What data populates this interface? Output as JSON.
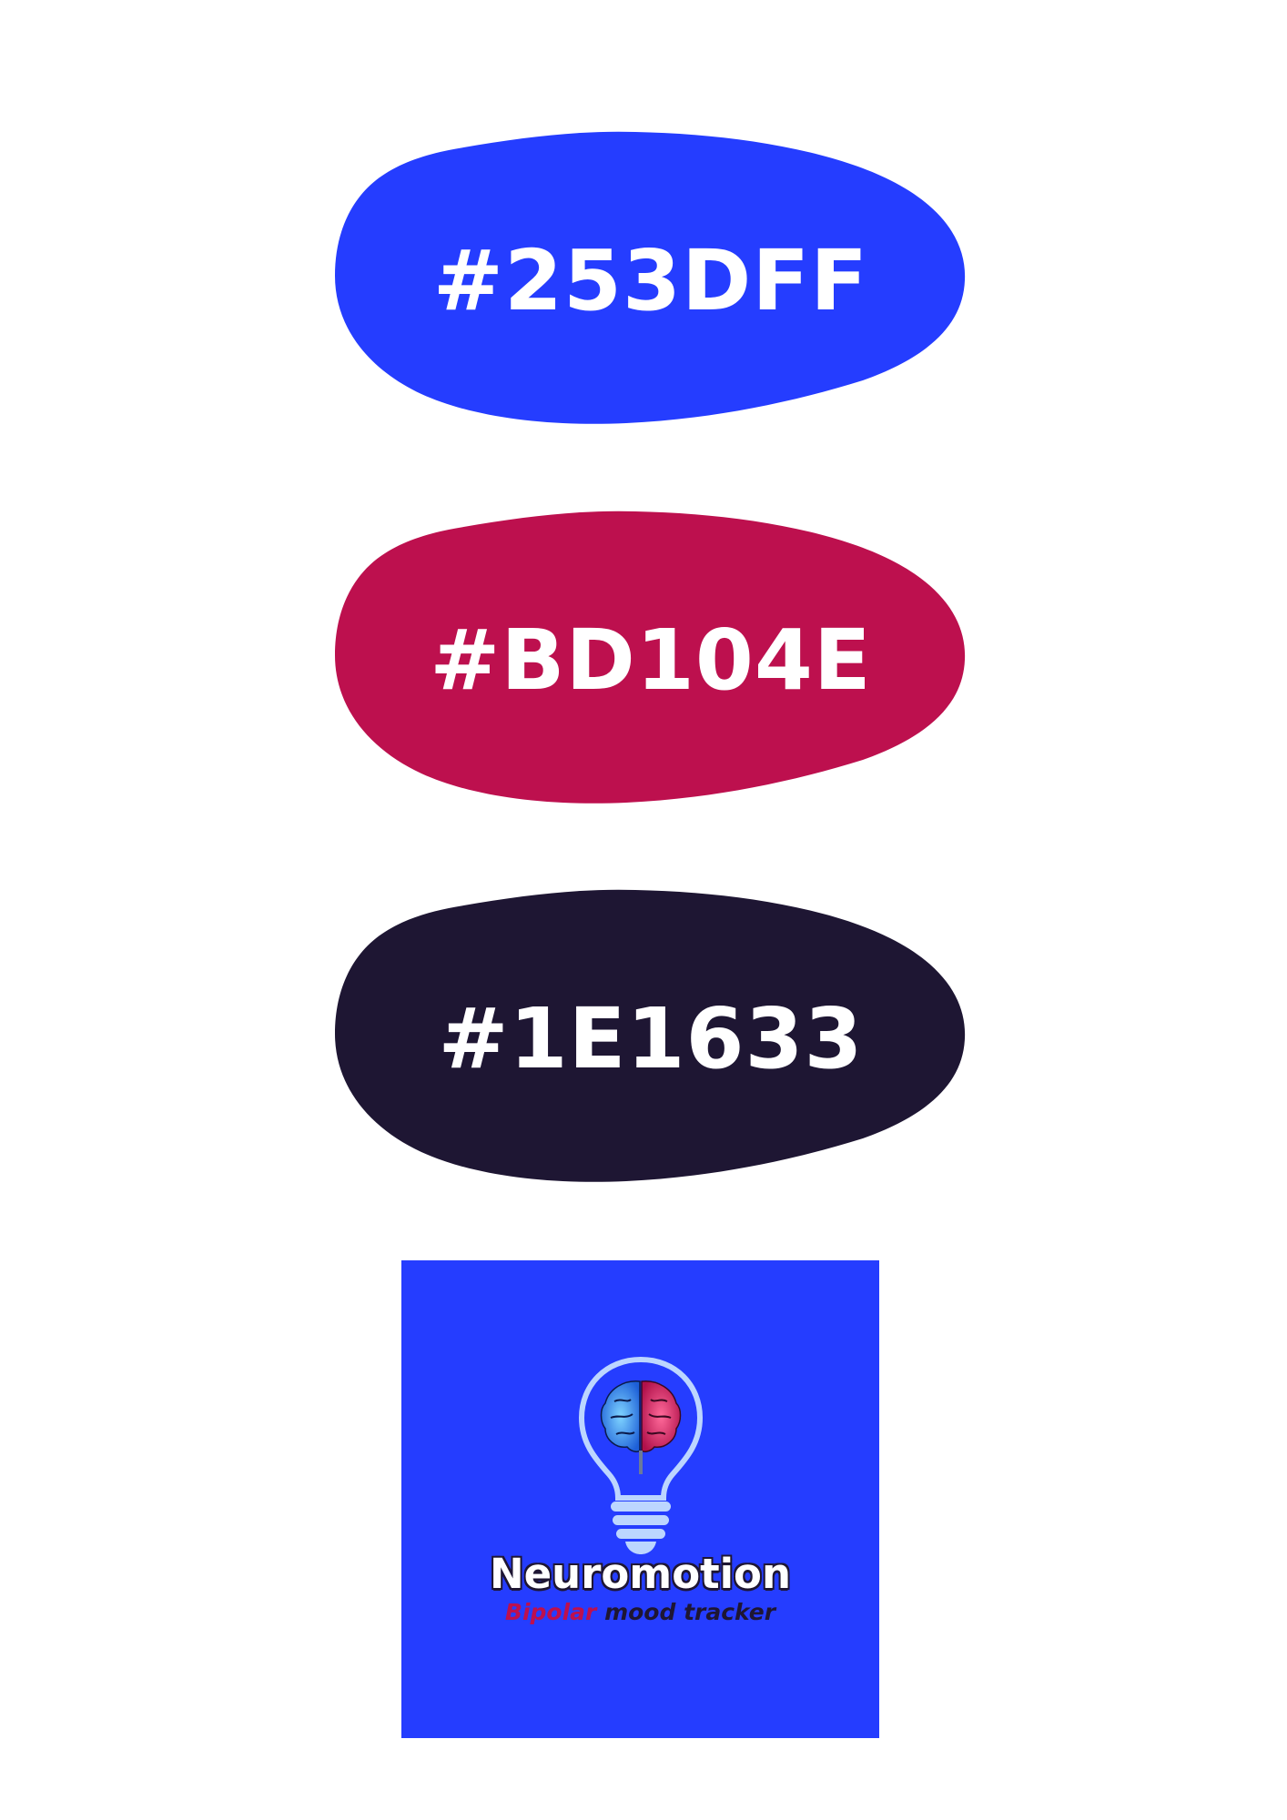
{
  "swatches": [
    {
      "hex_label": "#253DFF",
      "color": "#253DFF"
    },
    {
      "hex_label": "#BD104E",
      "color": "#BD104E"
    },
    {
      "hex_label": "#1E1633",
      "color": "#1E1633"
    }
  ],
  "logo": {
    "background_color": "#253DFF",
    "icon": "lightbulb-brain-icon",
    "title": "Neuromotion",
    "tagline_part1": "Bipolar",
    "tagline_part2": " mood tracker",
    "tagline_part1_color": "#BD104E",
    "tagline_part2_color": "#1E1633"
  }
}
